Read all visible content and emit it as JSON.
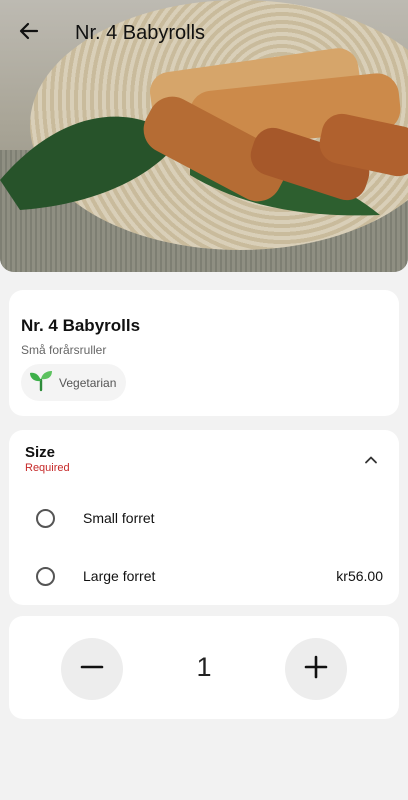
{
  "header": {
    "title": "Nr. 4 Babyrolls",
    "back_icon": "arrow-left-icon"
  },
  "hero": {
    "image": "spring-rolls-photo"
  },
  "item": {
    "name": "Nr. 4 Babyrolls",
    "subtitle": "Små forårsruller",
    "tag": {
      "label": "Vegetarian",
      "icon": "seedling-icon"
    }
  },
  "size_group": {
    "title": "Size",
    "required_label": "Required",
    "collapse_icon": "chevron-up-icon",
    "options": [
      {
        "label": "Small forret",
        "price": ""
      },
      {
        "label": "Large forret",
        "price": "kr56.00"
      }
    ]
  },
  "quantity": {
    "value": "1",
    "minus_icon": "minus-icon",
    "plus_icon": "plus-icon"
  },
  "colors": {
    "background": "#f2f2f2",
    "card": "#ffffff",
    "required": "#c62828",
    "vegetarian_icon": "#3db04a"
  }
}
